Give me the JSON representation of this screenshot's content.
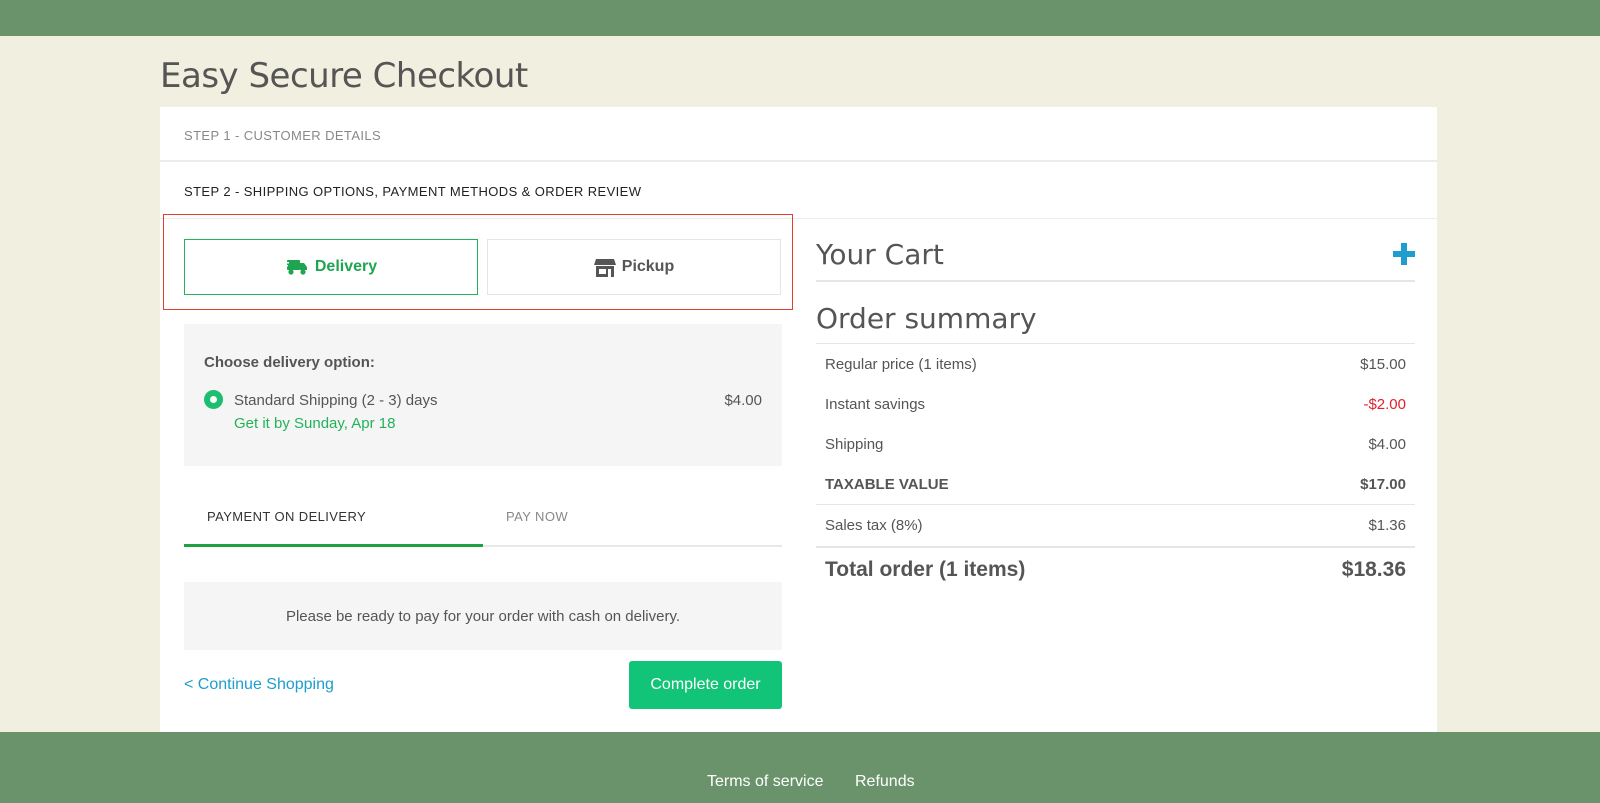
{
  "page": {
    "title": "Easy Secure Checkout"
  },
  "steps": {
    "step1": "STEP 1 - CUSTOMER DETAILS",
    "step2": "STEP 2 - SHIPPING OPTIONS, PAYMENT METHODS & ORDER REVIEW"
  },
  "shipping_methods": {
    "delivery": {
      "label": "Delivery",
      "icon": "truck-icon",
      "selected": true
    },
    "pickup": {
      "label": "Pickup",
      "icon": "store-icon",
      "selected": false
    }
  },
  "delivery_options": {
    "heading": "Choose delivery option:",
    "option": {
      "name": "Standard Shipping (2 - 3) days",
      "eta": "Get it by Sunday, Apr 18",
      "price": "$4.00",
      "selected": true
    }
  },
  "payment": {
    "tabs": [
      {
        "label": "PAYMENT ON DELIVERY",
        "active": true
      },
      {
        "label": "PAY NOW",
        "active": false
      }
    ],
    "note": "Please be ready to pay for your order with cash on delivery."
  },
  "actions": {
    "continue": "< Continue Shopping",
    "complete": "Complete order"
  },
  "cart": {
    "title": "Your Cart",
    "add_icon": "plus-icon"
  },
  "summary": {
    "title": "Order summary",
    "rows": [
      {
        "label": "Regular price (1 items)",
        "value": "$15.00"
      },
      {
        "label": "Instant savings",
        "value": "-$2.00"
      },
      {
        "label": "Shipping",
        "value": "$4.00"
      },
      {
        "label": "TAXABLE VALUE",
        "value": "$17.00"
      },
      {
        "label": "Sales tax (8%)",
        "value": "$1.36"
      },
      {
        "label": "Total order (1 items)",
        "value": "$18.36"
      }
    ]
  },
  "footer": {
    "links": [
      "Terms of service",
      "Refunds"
    ]
  },
  "colors": {
    "header_green": "#6b936b",
    "page_background": "#f1efdf",
    "accent_green": "#12c478",
    "link_blue": "#1d9ecc",
    "negative_red": "#e0202f",
    "highlight_box": "#e0402e"
  }
}
